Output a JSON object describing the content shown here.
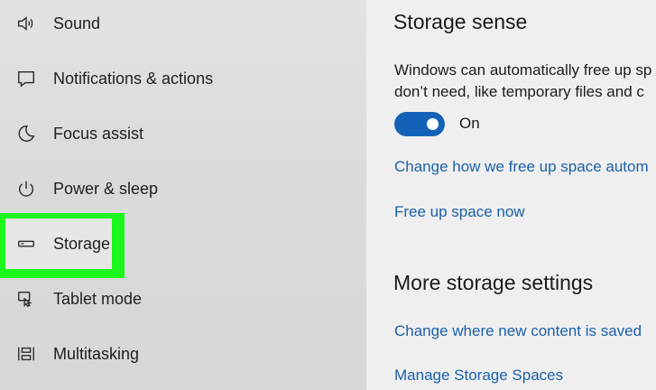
{
  "sidebar": {
    "items": [
      {
        "label": "Sound",
        "icon": "speaker-icon"
      },
      {
        "label": "Notifications & actions",
        "icon": "message-icon"
      },
      {
        "label": "Focus assist",
        "icon": "moon-icon"
      },
      {
        "label": "Power & sleep",
        "icon": "power-icon"
      },
      {
        "label": "Storage",
        "icon": "storage-drive-icon",
        "selected": true
      },
      {
        "label": "Tablet mode",
        "icon": "tablet-mode-icon"
      },
      {
        "label": "Multitasking",
        "icon": "multitasking-icon"
      }
    ],
    "highlight_color": "#1bf61b"
  },
  "main": {
    "storage_sense": {
      "title": "Storage sense",
      "description_line1": "Windows can automatically free up sp",
      "description_line2": "don’t need, like temporary files and c",
      "toggle_state": "On",
      "toggle_color": "#1462b8",
      "link_change_how": "Change how we free up space autom",
      "link_free_up": "Free up space now"
    },
    "more_storage": {
      "title": "More storage settings",
      "link_change_where": "Change where new content is saved",
      "link_manage": "Manage Storage Spaces"
    }
  }
}
